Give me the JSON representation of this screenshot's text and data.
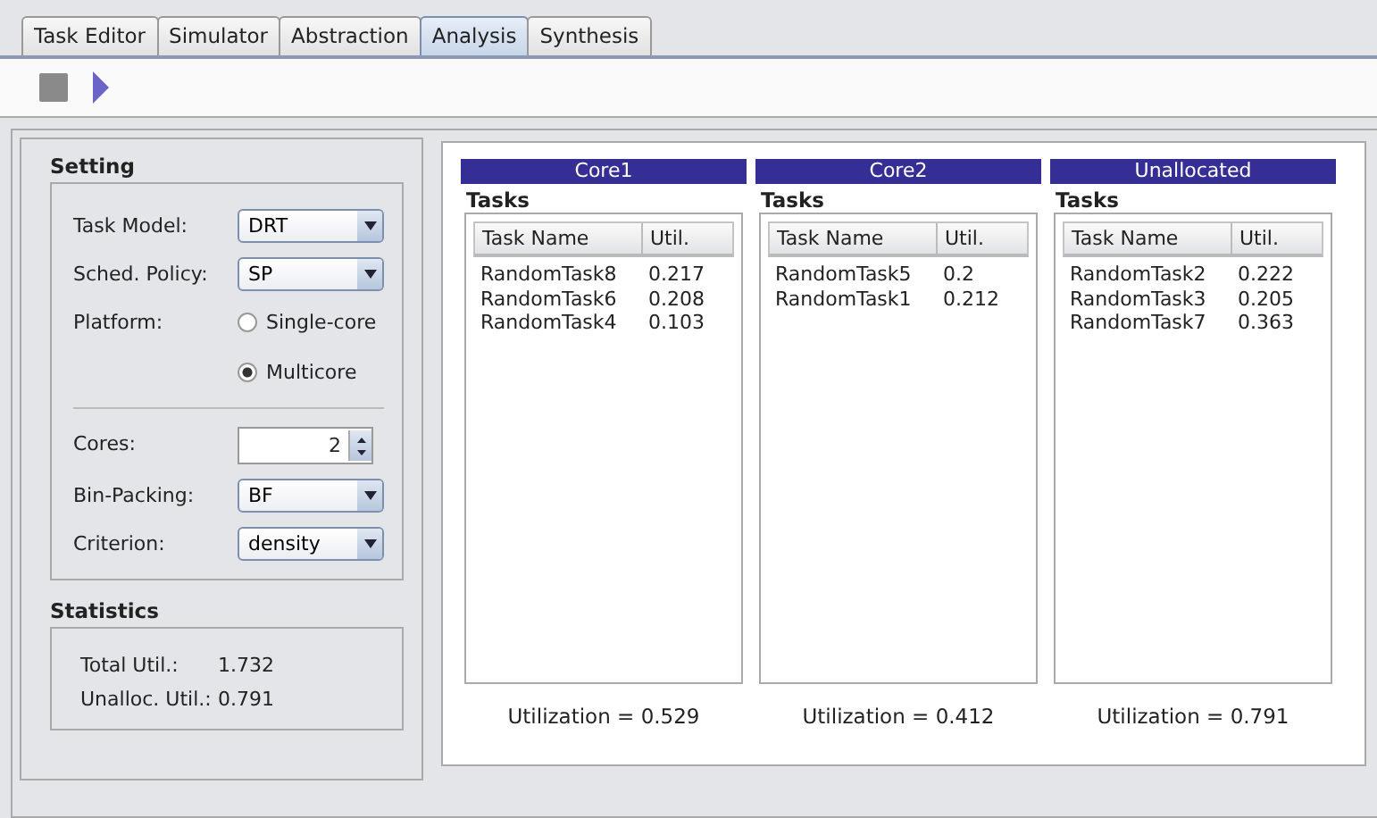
{
  "tabs": [
    {
      "label": "Task Editor",
      "selected": false
    },
    {
      "label": "Simulator",
      "selected": false
    },
    {
      "label": "Abstraction",
      "selected": false
    },
    {
      "label": "Analysis",
      "selected": true
    },
    {
      "label": "Synthesis",
      "selected": false
    }
  ],
  "setting": {
    "title": "Setting",
    "task_model": {
      "label": "Task Model:",
      "value": "DRT"
    },
    "sched_policy": {
      "label": "Sched. Policy:",
      "value": "SP"
    },
    "platform": {
      "label": "Platform:",
      "options": [
        {
          "label": "Single-core",
          "selected": false
        },
        {
          "label": "Multicore",
          "selected": true
        }
      ]
    },
    "cores": {
      "label": "Cores:",
      "value": "2"
    },
    "bin_packing": {
      "label": "Bin-Packing:",
      "value": "BF"
    },
    "criterion": {
      "label": "Criterion:",
      "value": "density"
    }
  },
  "statistics": {
    "title": "Statistics",
    "rows": [
      {
        "label": "Total Util.:",
        "value": "1.732"
      },
      {
        "label": "Unalloc. Util.:",
        "value": "0.791"
      }
    ]
  },
  "cores": [
    {
      "title": "Core1",
      "tasks_label": "Tasks",
      "columns": [
        "Task Name",
        "Util."
      ],
      "rows": [
        [
          "RandomTask8",
          "0.217"
        ],
        [
          "RandomTask6",
          "0.208"
        ],
        [
          "RandomTask4",
          "0.103"
        ]
      ],
      "utilization": "Utilization = 0.529"
    },
    {
      "title": "Core2",
      "tasks_label": "Tasks",
      "columns": [
        "Task Name",
        "Util."
      ],
      "rows": [
        [
          "RandomTask5",
          "0.2"
        ],
        [
          "RandomTask1",
          "0.212"
        ]
      ],
      "utilization": "Utilization = 0.412"
    },
    {
      "title": "Unallocated",
      "tasks_label": "Tasks",
      "columns": [
        "Task Name",
        "Util."
      ],
      "rows": [
        [
          "RandomTask2",
          "0.222"
        ],
        [
          "RandomTask3",
          "0.205"
        ],
        [
          "RandomTask7",
          "0.363"
        ]
      ],
      "utilization": "Utilization = 0.791"
    }
  ]
}
